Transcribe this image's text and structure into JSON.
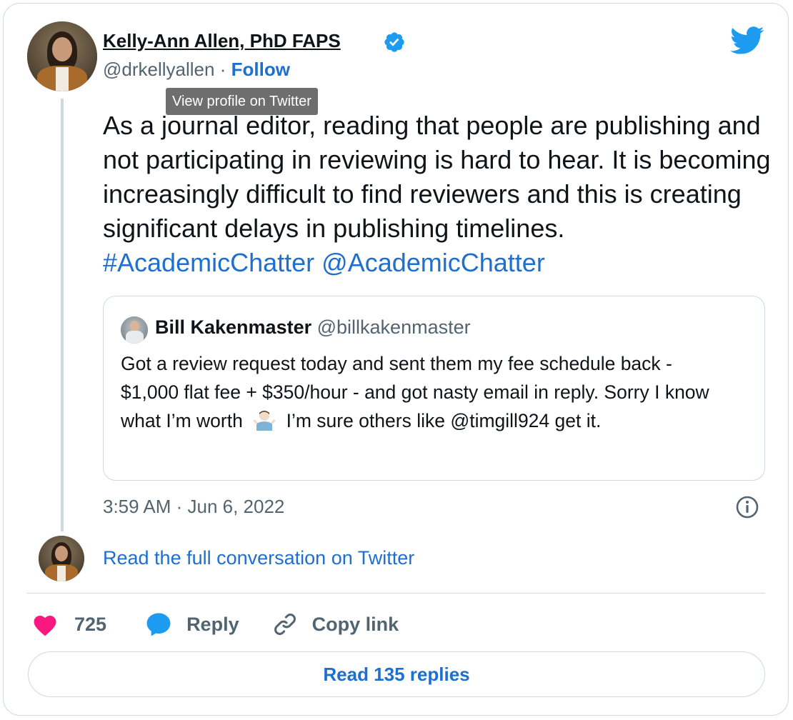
{
  "author": {
    "name": "Kelly-Ann Allen, PhD FAPS",
    "handle": "@drkellyallen",
    "separator": "·",
    "follow_label": "Follow"
  },
  "tooltip": "View profile on Twitter",
  "tweet": {
    "text": "As a journal editor, reading that people are publishing and not participating in reviewing is hard to hear. It is becoming increasingly difficult to find reviewers and this is creating significant delays in publishing timelines.",
    "hashtag": "#AcademicChatter",
    "mention": "@AcademicChatter",
    "timestamp": "3:59 AM · Jun 6, 2022"
  },
  "quoted_tweet": {
    "name": "Bill Kakenmaster",
    "handle": "@billkakenmaster",
    "text_part1": "Got a review request today and sent them my fee schedule back - $1,000 flat fee + $350/hour - and got nasty email in reply. Sorry I know what I’m worth",
    "emoji": "person-shrugging-emoji",
    "text_part2": "I’m sure others like @timgill924 get it."
  },
  "read_full_label": "Read the full conversation on Twitter",
  "actions": {
    "likes_count": "725",
    "reply_label": "Reply",
    "copy_link_label": "Copy link"
  },
  "read_replies_label": "Read 135 replies",
  "colors": {
    "link": "#1d6fd0",
    "twitter_blue": "#1d9bf0",
    "heart": "#f91880",
    "secondary_text": "#536471",
    "border": "#cfd9de"
  },
  "icons": [
    "verified-badge-icon",
    "twitter-bird-icon",
    "info-icon",
    "heart-icon",
    "reply-bubble-icon",
    "link-icon"
  ]
}
